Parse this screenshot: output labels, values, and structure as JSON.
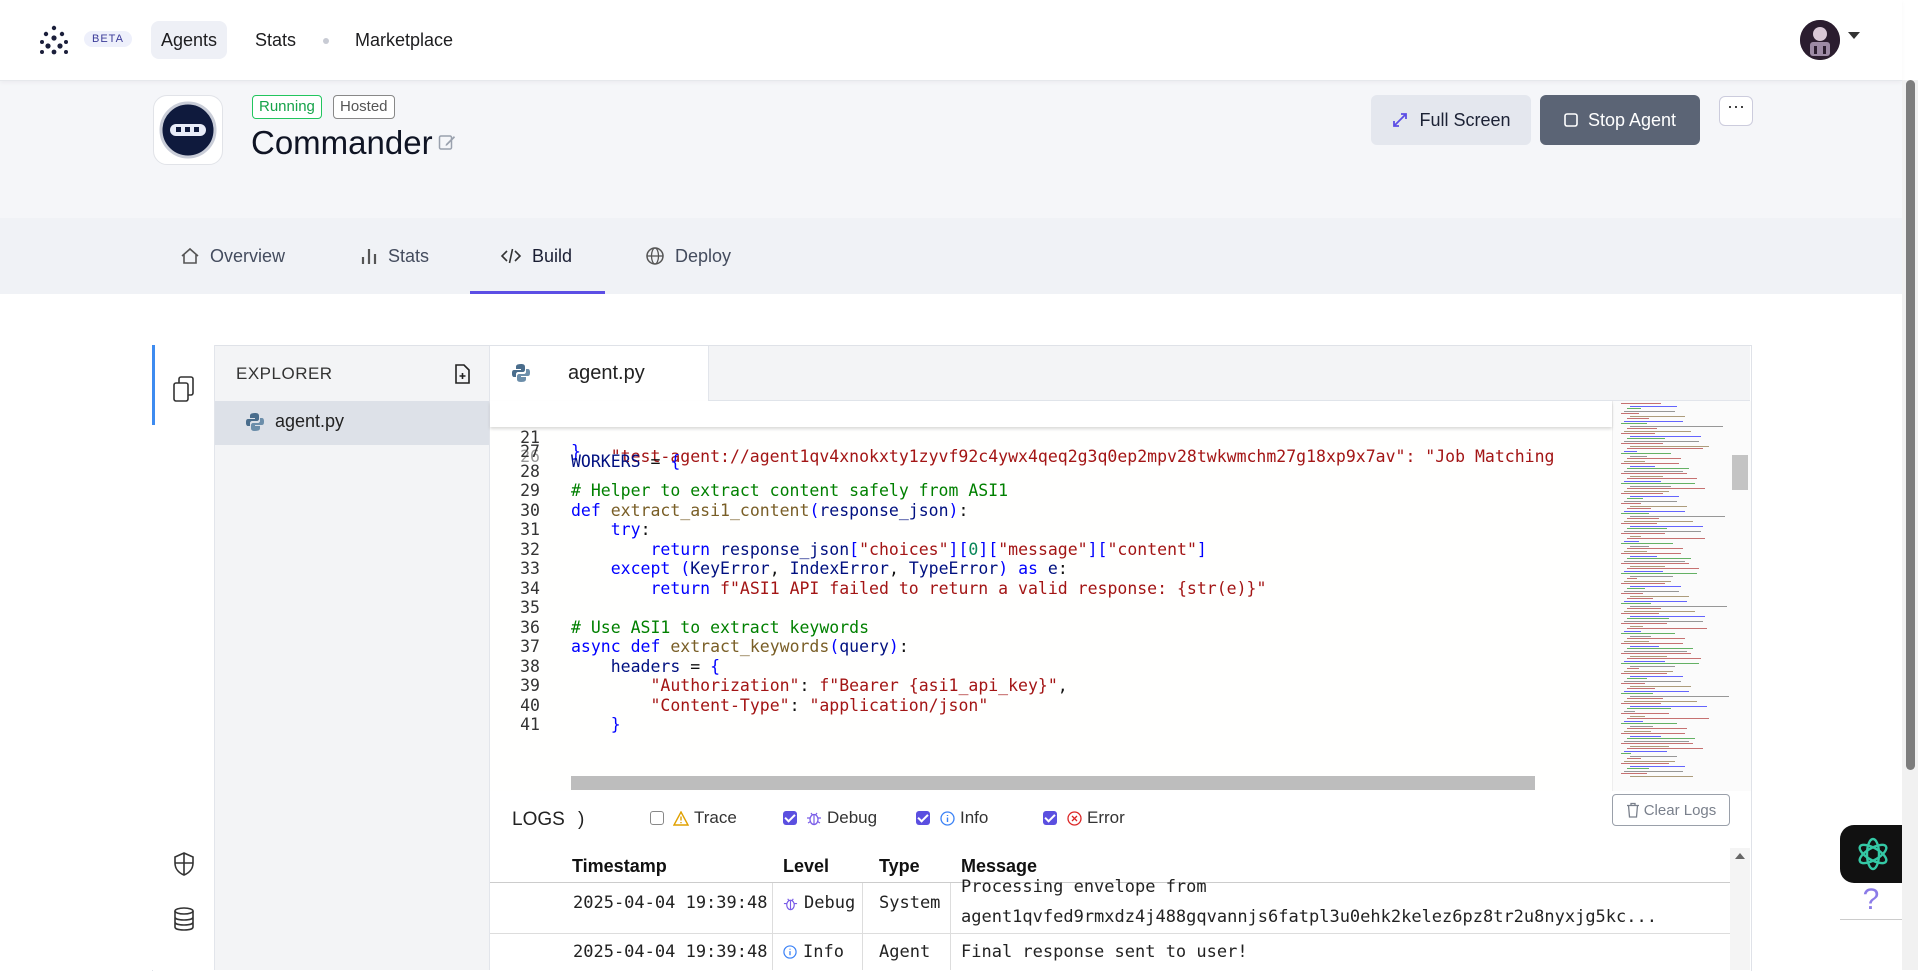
{
  "nav": {
    "beta": "BETA",
    "links": [
      "Agents",
      "Stats",
      "Marketplace"
    ]
  },
  "agent": {
    "status": "Running",
    "hosting": "Hosted",
    "name": "Commander"
  },
  "actions": {
    "full_screen": "Full Screen",
    "stop_agent": "Stop Agent",
    "more": "⋯"
  },
  "tabs": [
    "Overview",
    "Stats",
    "Build",
    "Deploy"
  ],
  "explorer": {
    "title": "EXPLORER",
    "files": [
      "agent.py"
    ]
  },
  "editor": {
    "open_tab": "agent.py",
    "sticky_line": {
      "num": "21",
      "text": "WORKERS = {"
    },
    "peek_text": "    \"test-agent://agent1qv4xnokxty1zyvf92c4ywx4qeq2g3q0ep2mpv28twkwmchm27g18xp9x7av\": \"Job Matching",
    "lines": [
      {
        "num": "27",
        "text": "}"
      },
      {
        "num": "28",
        "text": ""
      },
      {
        "num": "29",
        "text": "# Helper to extract content safely from ASI1"
      },
      {
        "num": "30",
        "text": "def extract_asi1_content(response_json):"
      },
      {
        "num": "31",
        "text": "    try:"
      },
      {
        "num": "32",
        "text": "        return response_json[\"choices\"][0][\"message\"][\"content\"]"
      },
      {
        "num": "33",
        "text": "    except (KeyError, IndexError, TypeError) as e:"
      },
      {
        "num": "34",
        "text": "        return f\"ASI1 API failed to return a valid response: {str(e)}\""
      },
      {
        "num": "35",
        "text": ""
      },
      {
        "num": "36",
        "text": "# Use ASI1 to extract keywords"
      },
      {
        "num": "37",
        "text": "async def extract_keywords(query):"
      },
      {
        "num": "38",
        "text": "    headers = {"
      },
      {
        "num": "39",
        "text": "        \"Authorization\": f\"Bearer {asi1_api_key}\","
      },
      {
        "num": "40",
        "text": "        \"Content-Type\": \"application/json\""
      },
      {
        "num": "41",
        "text": "    }"
      }
    ]
  },
  "logs": {
    "title": "LOGS",
    "paren": ")",
    "levels": [
      {
        "label": "Trace",
        "checked": false
      },
      {
        "label": "Debug",
        "checked": true
      },
      {
        "label": "Info",
        "checked": true
      },
      {
        "label": "Error",
        "checked": true
      }
    ],
    "clear_label": "Clear Logs",
    "columns": [
      "Timestamp",
      "Level",
      "Type",
      "Message"
    ],
    "rows": [
      {
        "timestamp": "2025-04-04 19:39:48",
        "level": "Debug",
        "type": "System",
        "message_line1": "Processing envelope from",
        "message_line2": "agent1qvfed9rmxdz4j488gqvannjs6fatpl3u0ehk2kelez6pz8tr2u8nyxjg5kc..."
      },
      {
        "timestamp": "2025-04-04 19:39:48",
        "level": "Info",
        "type": "Agent",
        "message_line1": "Final response sent to user!",
        "message_line2": ""
      }
    ]
  },
  "help": "?",
  "colors": {
    "accent": "#5c4ee5",
    "running": "#16a34a",
    "stop_button": "#5b6475"
  }
}
